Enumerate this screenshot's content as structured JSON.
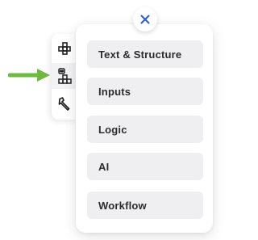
{
  "toolbar": {
    "tools": [
      {
        "name": "structure-tool",
        "icon": "structure-grid-icon"
      },
      {
        "name": "robot-tool",
        "icon": "robot-grid-icon",
        "active": true
      },
      {
        "name": "wrench-tool",
        "icon": "wrench-icon"
      }
    ]
  },
  "annotation": {
    "icon": "green-arrow-icon",
    "color": "#6dbb3c"
  },
  "close": {
    "icon": "close-icon",
    "glyph": "✕",
    "color": "#2a5bd7"
  },
  "menu": {
    "items": [
      {
        "label": "Text & Structure"
      },
      {
        "label": "Inputs"
      },
      {
        "label": "Logic"
      },
      {
        "label": "AI"
      },
      {
        "label": "Workflow"
      }
    ]
  },
  "colors": {
    "item_bg": "#efeff1",
    "item_text": "#2c2c2c",
    "accent_blue": "#2a5bd7",
    "arrow_green": "#6dbb3c"
  }
}
